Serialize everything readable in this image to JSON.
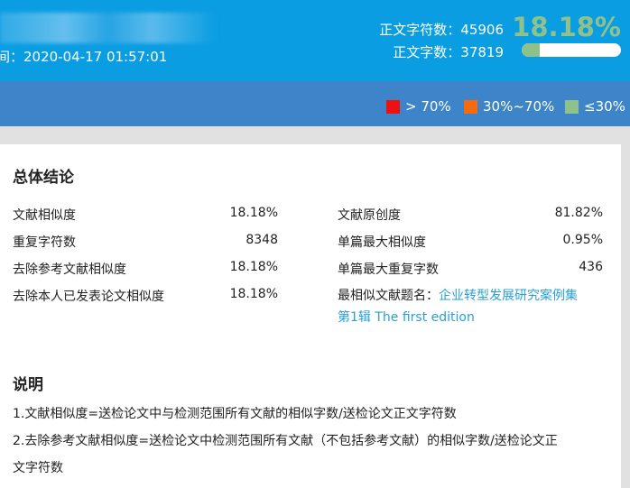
{
  "header": {
    "time_label": "间：2020-04-17 01:57:01",
    "char_count_label": "正文字符数：45906",
    "word_count_label": "正文字数：37819",
    "similarity": "18.18%",
    "similarity_fraction": 0.1818,
    "accent": "#8fc28a"
  },
  "legend": [
    {
      "label": "> 70%",
      "color": "#ee1111"
    },
    {
      "label": "30%~70%",
      "color": "#f86a10"
    },
    {
      "label": "≤30%",
      "color": "#8fc28a"
    }
  ],
  "summary": {
    "title": "总体结论",
    "left": [
      {
        "label": "文献相似度",
        "value": "18.18%"
      },
      {
        "label": "重复字符数",
        "value": "8348"
      },
      {
        "label": "去除参考文献相似度",
        "value": "18.18%"
      },
      {
        "label": "去除本人已发表论文相似度",
        "value": "18.18%"
      }
    ],
    "right": [
      {
        "label": "文献原创度",
        "value": "81.82%"
      },
      {
        "label": "单篇最大相似度",
        "value": "0.95%"
      },
      {
        "label": "单篇最大重复字数",
        "value": "436"
      }
    ],
    "most_similar_label": "最相似文献题名：",
    "most_similar_title_1": "企业转型发展研究案例集",
    "most_similar_title_2": "第1辑 The first edition"
  },
  "notes": {
    "title": "说明",
    "lines": [
      "1.文献相似度=送检论文中与检测范围所有文献的相似字数/送检论文正文字符数",
      "2.去除参考文献相似度=送检论文中检测范围所有文献（不包括参考文献）的相似字数/送检论文正",
      "文字符数"
    ]
  }
}
